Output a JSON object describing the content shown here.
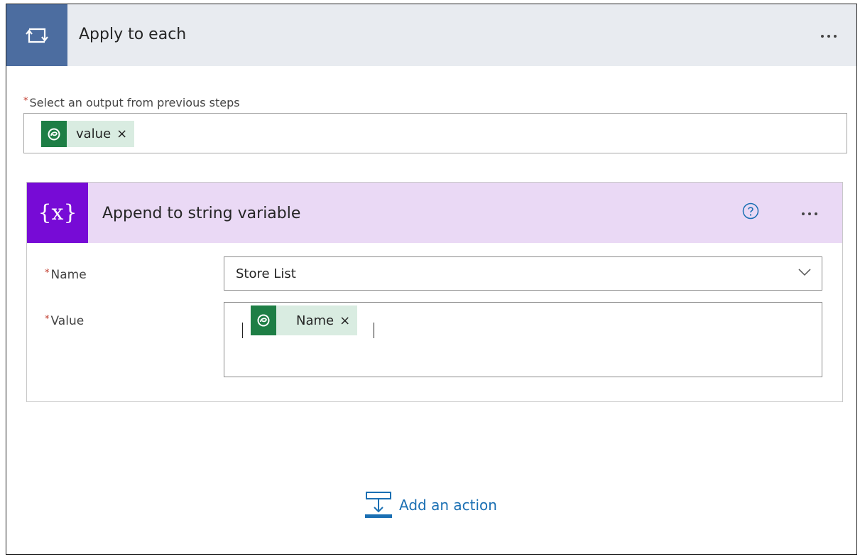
{
  "apply_to_each": {
    "title": "Apply to each",
    "icon": "loop-icon",
    "output_field": {
      "required_mark": "*",
      "label": "Select an output from previous steps",
      "token": {
        "label": "value",
        "remove": "×",
        "icon": "dataverse-icon"
      }
    }
  },
  "append_action": {
    "title": "Append to string variable",
    "icon_glyph": "{x}",
    "name_field": {
      "required_mark": "*",
      "label": "Name",
      "value": "Store List"
    },
    "value_field": {
      "required_mark": "*",
      "label": "Value",
      "token": {
        "label": "Name",
        "remove": "×",
        "icon": "dataverse-icon"
      }
    }
  },
  "add_action": {
    "label": "Add an action"
  },
  "colors": {
    "apply_icon_bg": "#4c6da0",
    "apply_header_bg": "#e8ebf0",
    "variable_icon_bg": "#770bd6",
    "variable_header_bg": "#ead9f5",
    "token_icon_bg": "#1e7e45",
    "token_bg": "#d9ece1",
    "link_blue": "#1a6fb3"
  }
}
